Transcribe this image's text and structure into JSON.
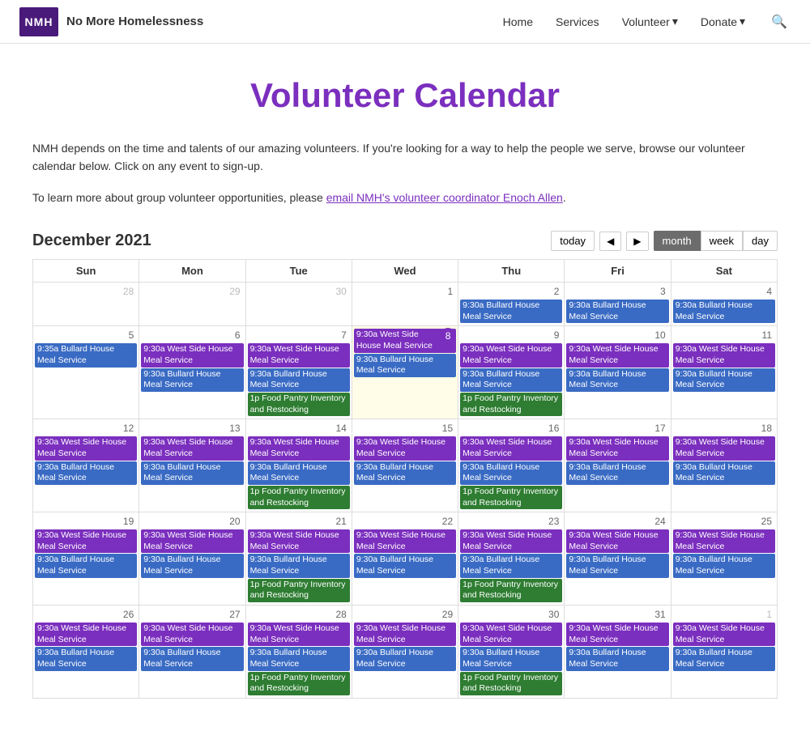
{
  "header": {
    "logo_text": "NMH",
    "org_name": "No More Homelessness",
    "nav": [
      {
        "label": "Home",
        "href": "#"
      },
      {
        "label": "Services",
        "href": "#"
      },
      {
        "label": "Volunteer",
        "dropdown": true,
        "href": "#"
      },
      {
        "label": "Donate",
        "dropdown": true,
        "href": "#"
      }
    ]
  },
  "page": {
    "title": "Volunteer Calendar",
    "intro1": "NMH depends on the time and talents of our amazing volunteers. If you're looking for a way to help the people we serve, browse our volunteer calendar below. Click on any event to sign-up.",
    "intro2": "To learn more about group volunteer opportunities, please ",
    "intro_link": "email NMH's volunteer coordinator Enoch Allen",
    "intro2_end": "."
  },
  "calendar": {
    "month_title": "December 2021",
    "today_btn": "today",
    "view_month": "month",
    "view_week": "week",
    "view_day": "day",
    "days_of_week": [
      "Sun",
      "Mon",
      "Tue",
      "Wed",
      "Thu",
      "Fri",
      "Sat"
    ],
    "events": {
      "bullard_meal": "9:30a Bullard House Meal Service",
      "westside_meal": "9:30a West Side House Meal Service",
      "food_pantry": "1p Food Pantry Inventory and Restocking"
    }
  }
}
